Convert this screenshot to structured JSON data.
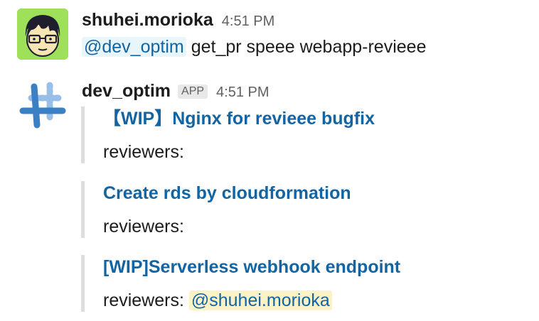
{
  "messages": [
    {
      "username": "shuhei.morioka",
      "time": "4:51 PM",
      "mention": "@dev_optim",
      "text": "get_pr speee webapp-revieee"
    },
    {
      "username": "dev_optim",
      "badge": "APP",
      "time": "4:51 PM",
      "attachments": [
        {
          "title": "【WIP】Nginx for revieee bugfix",
          "label": "reviewers:",
          "mention": ""
        },
        {
          "title": "Create rds by cloudformation",
          "label": "reviewers:",
          "mention": ""
        },
        {
          "title": "[WIP]Serverless webhook endpoint",
          "label": "reviewers:",
          "mention": "@shuhei.morioka"
        }
      ]
    }
  ],
  "colors": {
    "link": "#1264a3",
    "user_avatar_bg": "#9ee05a",
    "self_mention_bg": "#fcf2c8",
    "mention_bg": "#e8f5fa",
    "bot_icon_blue": "#3b7fc4"
  },
  "icons": {
    "user_avatar": "person-with-glasses-icon",
    "bot_avatar": "hash-slack-icon"
  }
}
